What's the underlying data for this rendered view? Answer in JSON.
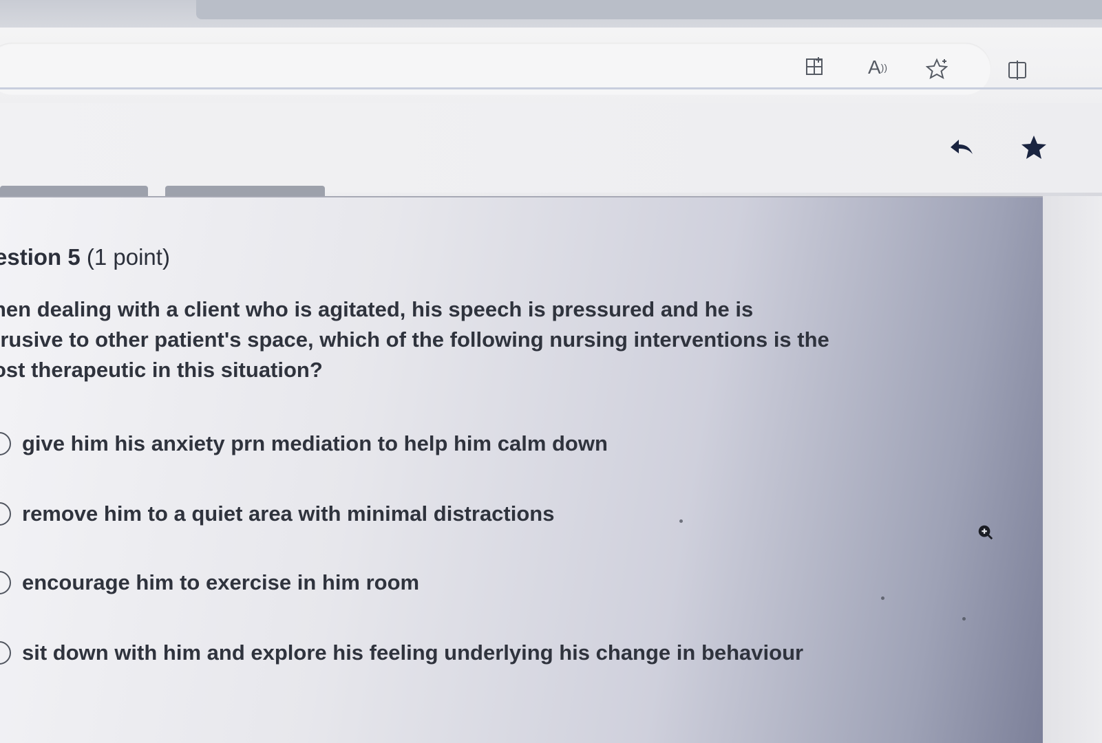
{
  "toolbar": {
    "icons": [
      "app-grid-icon",
      "read-aloud-icon",
      "favorite-star-icon",
      "split-screen-icon"
    ],
    "read_aloud_label": "A"
  },
  "page_header": {
    "icons": [
      "reply-arrow-icon",
      "bookmark-star-icon"
    ]
  },
  "question": {
    "title": "estion 5",
    "points": "(1 point)",
    "text_lines": [
      "hen dealing with a client who is agitated, his speech is pressured and he is",
      "trusive to other patient's space, which of the following nursing interventions is the",
      "ost therapeutic in this situation?"
    ],
    "options": [
      {
        "label": "give him his anxiety prn mediation to help him calm down",
        "selected": false
      },
      {
        "label": "remove him to a quiet area with minimal distractions",
        "selected": false
      },
      {
        "label": "encourage him to exercise in him room",
        "selected": false
      },
      {
        "label": "sit down with him and explore his feeling underlying his change in behaviour",
        "selected": false
      }
    ]
  },
  "colors": {
    "text": "#2f333d",
    "toolbar_icon": "#555a63",
    "header_icon": "#1a2440"
  }
}
